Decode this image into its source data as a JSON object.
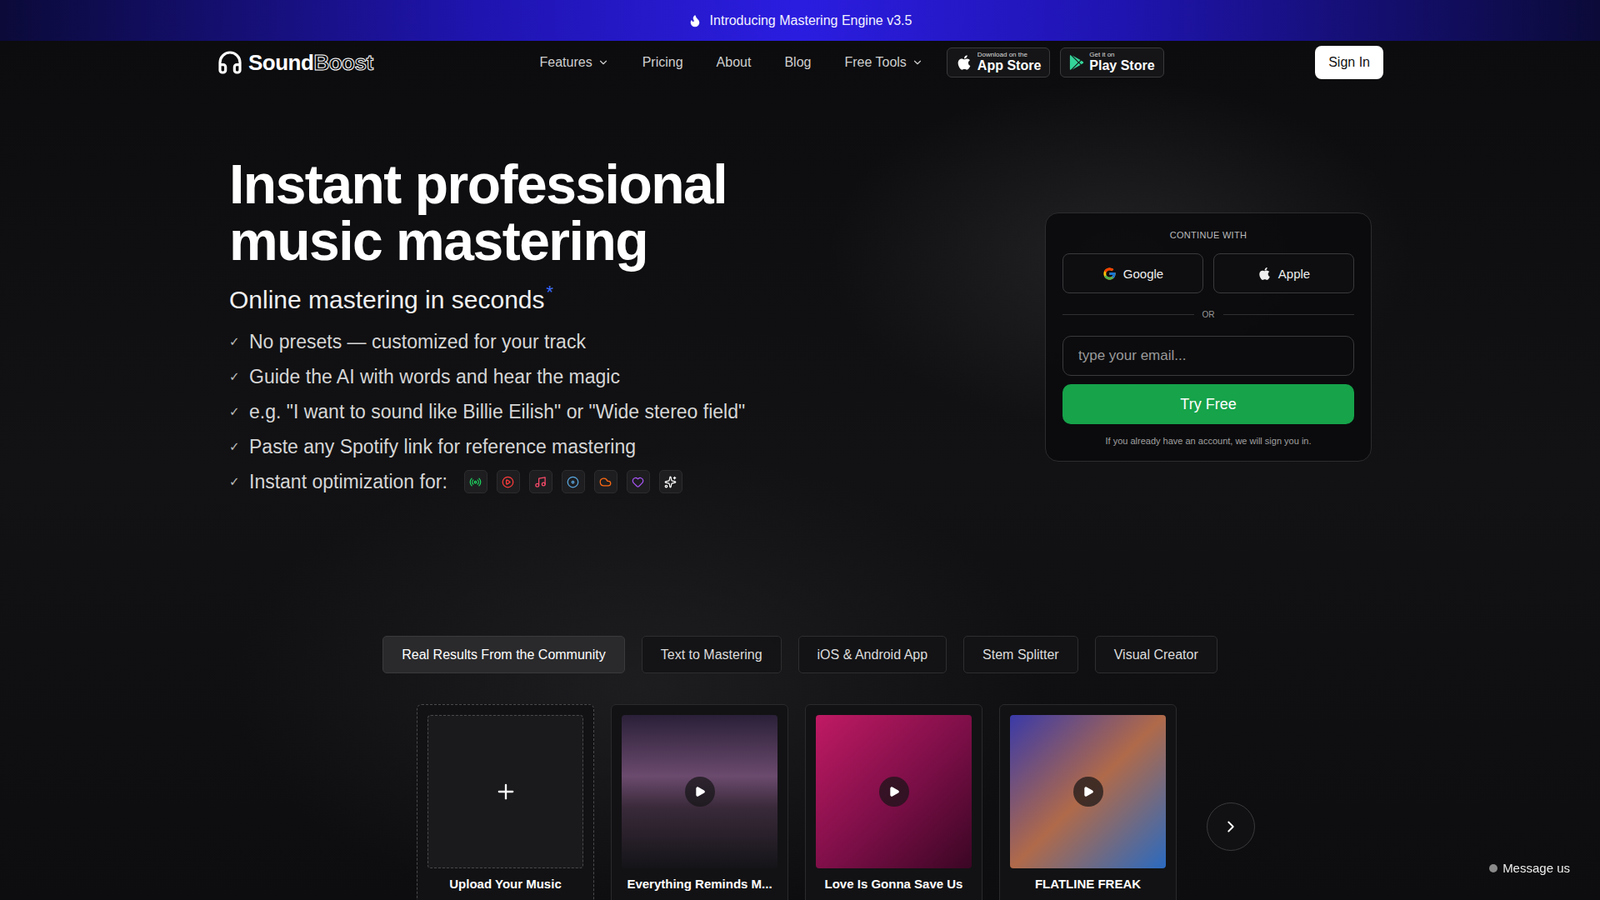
{
  "banner": {
    "text": "Introducing Mastering Engine v3.5"
  },
  "nav": {
    "logo": {
      "first": "Sound",
      "second": "Boost"
    },
    "links": [
      {
        "label": "Features",
        "dropdown": true
      },
      {
        "label": "Pricing",
        "dropdown": false
      },
      {
        "label": "About",
        "dropdown": false
      },
      {
        "label": "Blog",
        "dropdown": false
      },
      {
        "label": "Free Tools",
        "dropdown": true
      }
    ],
    "stores": [
      {
        "caption": "Download on the",
        "name": "App Store",
        "kind": "apple"
      },
      {
        "caption": "Get it on",
        "name": "Play Store",
        "kind": "google"
      }
    ],
    "sign_in": "Sign In"
  },
  "hero": {
    "title": [
      "Instant professional",
      "music mastering"
    ],
    "subtitle": "Online mastering in seconds",
    "subtitle_mark": "*",
    "check": "✓",
    "bullets": [
      "No presets — customized for your track",
      "Guide the AI with words and hear the magic",
      "e.g. \"I want to sound like Billie Eilish\" or \"Wide stereo field\"",
      "Paste any Spotify link for reference mastering",
      "Instant optimization for:"
    ],
    "platforms": [
      {
        "kind": "spotify",
        "color": "#1ed760"
      },
      {
        "kind": "youtube",
        "color": "#ff3b3b"
      },
      {
        "kind": "applemusic",
        "color": "#fa4a6a"
      },
      {
        "kind": "deezer",
        "color": "#5aa8e0"
      },
      {
        "kind": "soundcloud",
        "color": "#ff6a14"
      },
      {
        "kind": "heart",
        "color": "#a855f7"
      },
      {
        "kind": "tidal",
        "color": "#ffffff"
      }
    ]
  },
  "auth": {
    "heading": "CONTINUE WITH",
    "providers": [
      {
        "label": "Google",
        "kind": "google"
      },
      {
        "label": "Apple",
        "kind": "apple"
      }
    ],
    "divider": "OR",
    "email_placeholder": "type your email...",
    "submit": "Try Free",
    "note": "If you already have an account, we will sign you in."
  },
  "tabs": [
    {
      "label": "Real Results From the Community",
      "selected": true
    },
    {
      "label": "Text to Mastering",
      "selected": false
    },
    {
      "label": "iOS & Android App",
      "selected": false
    },
    {
      "label": "Stem Splitter",
      "selected": false
    },
    {
      "label": "Visual Creator",
      "selected": false
    }
  ],
  "tracks": [
    {
      "title": "Upload Your Music",
      "kind": "upload"
    },
    {
      "title": "Everything Reminds M...",
      "kind": "track"
    },
    {
      "title": "Love Is Gonna Save Us",
      "kind": "track"
    },
    {
      "title": "FLATLINE FREAK",
      "kind": "track"
    }
  ],
  "message": "Message us"
}
